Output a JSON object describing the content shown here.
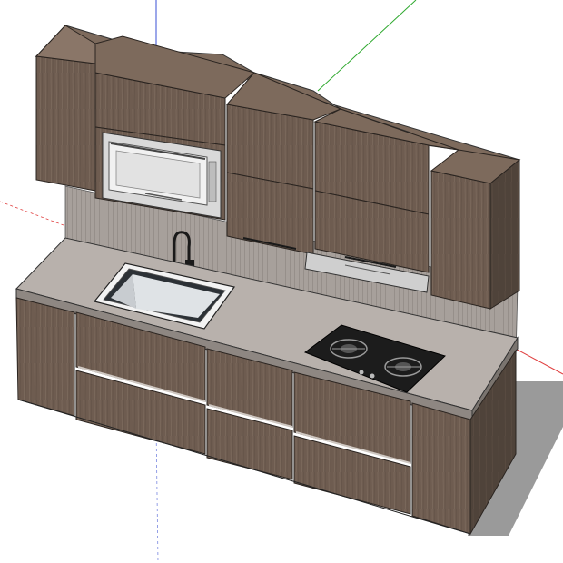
{
  "scene": {
    "subject": "kitchen-cabinet-model",
    "view": "isometric-3d",
    "background": "#ffffff",
    "colors": {
      "wood_front": "#6e5c50",
      "wood_side": "#4f433a",
      "wood_top": "#7d6a5c",
      "countertop": "#b8b1ac",
      "countertop_edge": "#8e8782",
      "backsplash": "#a7a09b",
      "shadow": "#9a9a9a",
      "cooktop": "#1c1c1c",
      "sink_steel": "#c8ccd0",
      "microwave_frame": "#d9d9d9",
      "axis_red": "#e04040",
      "axis_green": "#2ea82e",
      "axis_blue": "#3a4fd6"
    },
    "components": [
      "wall-cabinets",
      "microwave",
      "range-hood",
      "backsplash",
      "countertop",
      "sink",
      "faucet",
      "gas-cooktop",
      "base-cabinets"
    ],
    "icons": [
      "axis-red-icon",
      "axis-green-icon",
      "axis-blue-icon",
      "burner-icon"
    ]
  }
}
